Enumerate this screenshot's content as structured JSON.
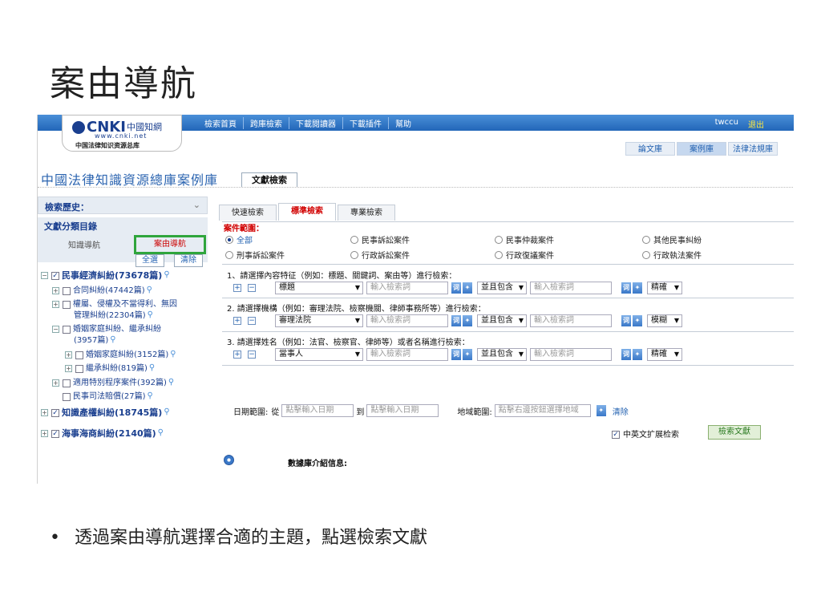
{
  "slide": {
    "title": "案由導航",
    "bullet": "透過案由導航選擇合適的主題，點選檢索文獻"
  },
  "logo": {
    "brand": "CNKI",
    "cn": "中國知網",
    "url": "www.cnki.net",
    "subtitle": "中国法律知识资源总库"
  },
  "topnav": {
    "items": [
      "檢索首頁",
      "跨庫檢索",
      "下載閱讀器",
      "下載插件",
      "幫助"
    ],
    "user": "twccu",
    "logout": "退出"
  },
  "library_tabs": [
    "論文庫",
    "案例庫",
    "法律法規庫"
  ],
  "db_title": "中國法律知識資源總庫案例庫",
  "doc_tab": "文獻檢索",
  "left": {
    "history": "檢索歷史：",
    "category_title": "文獻分類目錄",
    "nav_knowledge": "知識導航",
    "nav_case": "案由導航",
    "select_all": "全選",
    "clear": "清除",
    "tree": [
      {
        "label": "民事經濟糾紛(73678篇)",
        "bold": true,
        "pm": "−",
        "checked": true
      },
      {
        "label": "合同糾紛(47442篇)",
        "pm": "+"
      },
      {
        "label": "權屬、侵權及不當得利、無因",
        "pm": "+"
      },
      {
        "label": "管理糾紛(22304篇)"
      },
      {
        "label": "婚姻家庭糾紛、繼承糾紛",
        "pm": "−"
      },
      {
        "label": "(3957篇)"
      },
      {
        "label": "婚姻家庭糾紛(3152篇)",
        "pm": "+"
      },
      {
        "label": "繼承糾紛(819篇)",
        "pm": "+"
      },
      {
        "label": "適用特別程序案件(392篇)",
        "pm": "+"
      },
      {
        "label": "民事司法賠償(27篇)"
      },
      {
        "label": "知識產權糾紛(18745篇)",
        "bold": true,
        "pm": "+",
        "checked": true
      },
      {
        "label": "海事海商糾紛(2140篇)",
        "bold": true,
        "pm": "+",
        "checked": true
      }
    ]
  },
  "search_tabs": [
    "快速檢索",
    "標準檢索",
    "專業檢索"
  ],
  "scope": {
    "label": "案件範圍：",
    "options": [
      "全部",
      "民事訴訟案件",
      "民事仲裁案件",
      "其他民事糾紛",
      "刑事訴訟案件",
      "行政訴訟案件",
      "行政復議案件",
      "行政執法案件"
    ]
  },
  "rows": [
    {
      "label": "1、請選擇內容特征（例如：標題、關鍵詞、案由等）進行檢索：",
      "field": "標題",
      "mode": "精確"
    },
    {
      "label": "2. 請選擇機構（例如：審理法院、檢察機關、律師事務所等）進行檢索：",
      "field": "審理法院",
      "mode": "模糊"
    },
    {
      "label": "3. 請選擇姓名（例如：法官、檢察官、律師等）或者名稱進行檢索：",
      "field": "當事人",
      "mode": "精確"
    }
  ],
  "search": {
    "placeholder": "輸入檢索詞",
    "and_label": "並且包含"
  },
  "date": {
    "label": "日期範圍:",
    "from": "從",
    "to": "到",
    "placeholder": "點擊輸入日期",
    "region_label": "地域範圍:",
    "region_placeholder": "點擊右邊按鈕選擇地域",
    "clear": "清除"
  },
  "ext_label": "中英文扩展检索",
  "search_button": "檢索文獻",
  "db_info": "數據庫介紹信息:"
}
